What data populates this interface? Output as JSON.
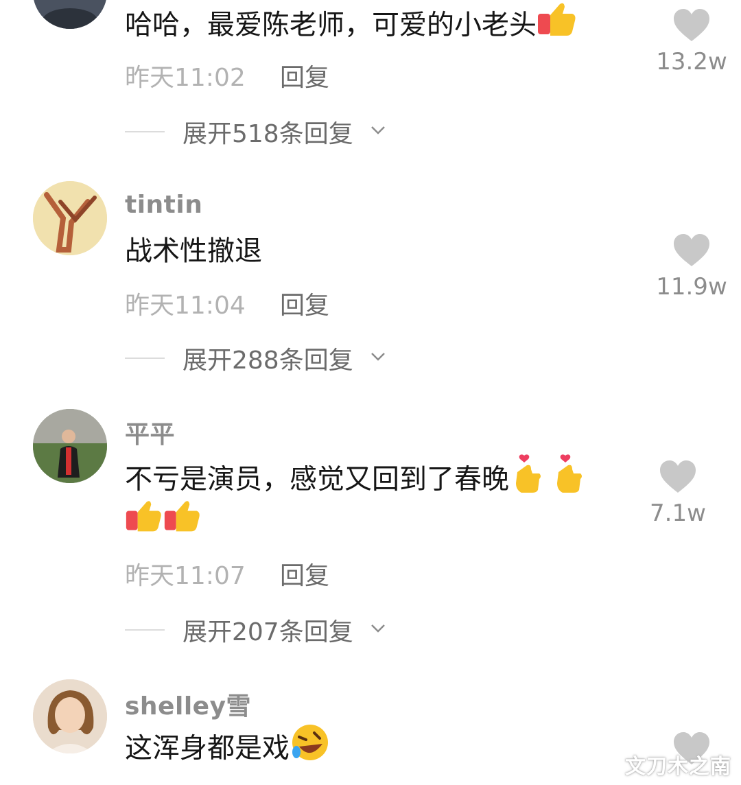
{
  "comments": [
    {
      "username": "",
      "text": "哈哈，最爱陈老师，可爱的小老头",
      "time": "昨天11:02",
      "reply_label": "回复",
      "expand_label": "展开518条回复",
      "likes": "13.2w"
    },
    {
      "username": "tintin",
      "text": "战术性撤退",
      "time": "昨天11:04",
      "reply_label": "回复",
      "expand_label": "展开288条回复",
      "likes": "11.9w"
    },
    {
      "username": "平平",
      "text": "不亏是演员，感觉又回到了春晚",
      "time": "昨天11:07",
      "reply_label": "回复",
      "expand_label": "展开207条回复",
      "likes": "7.1w"
    },
    {
      "username": "shelley雪",
      "text": "这浑身都是戏",
      "likes": ""
    }
  ],
  "watermark": "文刀木之南",
  "icons": {
    "like": "heart-icon",
    "expand": "chevron-down-icon",
    "thumbs_up": "thumbs-up-emoji",
    "finger_heart": "finger-heart-emoji",
    "laughing": "rofl-emoji"
  },
  "colors": {
    "text": "#161616",
    "muted": "#b2b2b2",
    "secondary": "#6b6b6b",
    "heart": "#c8c8c8"
  }
}
